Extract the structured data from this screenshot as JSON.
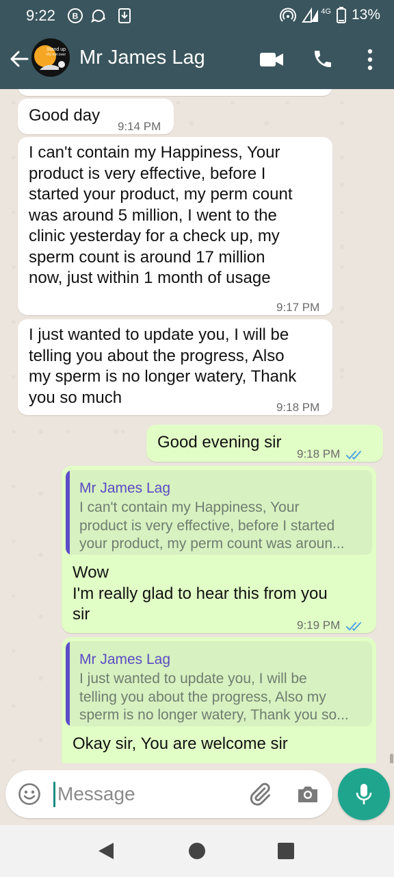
{
  "status_bar": {
    "time": "9:22",
    "network": "4G",
    "battery": "13%"
  },
  "header": {
    "contact_name": "Mr James Lag",
    "avatar_text_1": "Stand up",
    "avatar_text_2": "It's not over"
  },
  "messages": [
    {
      "direction": "incoming",
      "text": "Good day",
      "time": "9:14 PM"
    },
    {
      "direction": "incoming",
      "text": "I can't contain my Happiness, Your\nproduct is very effective, before I\nstarted your product, my perm count\nwas around 5 million, I went to the\nclinic yesterday for a check up, my\nsperm count is around 17 million\nnow, just within 1 month of usage",
      "time": "9:17 PM"
    },
    {
      "direction": "incoming",
      "text": "I just wanted to update you, I will be\ntelling you about the progress, Also\nmy sperm is no longer watery, Thank\nyou so much",
      "time": "9:18 PM"
    },
    {
      "direction": "outgoing",
      "text": "Good evening sir",
      "time": "9:18 PM",
      "status": "read"
    },
    {
      "direction": "outgoing",
      "quote_author": "Mr James Lag",
      "quote_text": "I can't contain my Happiness, Your\nproduct is very effective, before I started\nyour product, my perm count was aroun...",
      "text": "Wow\nI'm really glad to hear this from you\nsir",
      "time": "9:19 PM",
      "status": "read"
    },
    {
      "direction": "outgoing",
      "quote_author": "Mr James Lag",
      "quote_text": "I just wanted to update you, I will be\ntelling you about the progress, Also my\nsperm is no longer watery, Thank you so...",
      "text": "Okay sir, You are welcome sir"
    }
  ],
  "composer": {
    "placeholder": "Message"
  },
  "colors": {
    "header": "#3a555d",
    "outgoing_bubble": "#e1fec6",
    "incoming_bubble": "#ffffff",
    "read_ticks": "#4fa3e0",
    "mic_button": "#1fa58e"
  }
}
